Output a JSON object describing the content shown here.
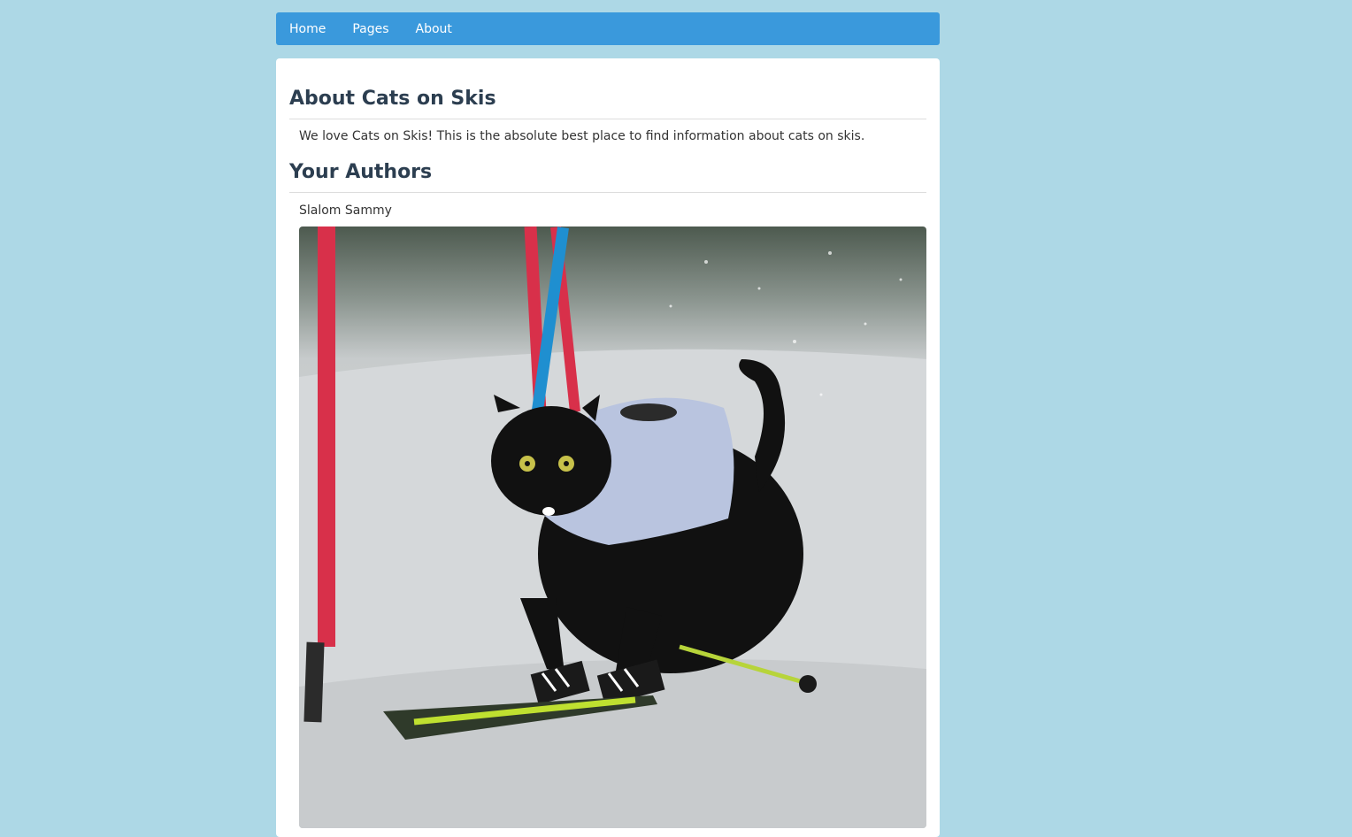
{
  "nav": {
    "items": [
      {
        "label": "Home"
      },
      {
        "label": "Pages"
      },
      {
        "label": "About"
      }
    ]
  },
  "about": {
    "heading": "About Cats on Skis",
    "intro": "We love Cats on Skis! This is the absolute best place to find information about cats on skis."
  },
  "authors": {
    "heading": "Your Authors",
    "list": [
      {
        "name": "Slalom Sammy"
      }
    ]
  },
  "colors": {
    "page_background": "#add8e6",
    "navbar": "#3a99dc",
    "heading_text": "#2c3e50"
  }
}
